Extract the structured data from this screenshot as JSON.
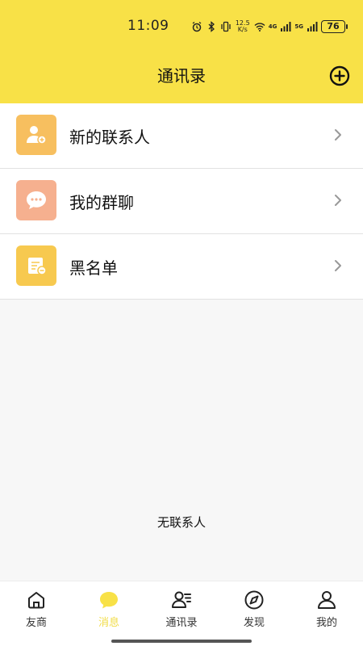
{
  "status_bar": {
    "time": "11:09",
    "net_speed_top": "12.5",
    "net_speed_bottom": "K/s",
    "signal1": "4G",
    "signal2": "5G",
    "battery": "76"
  },
  "header": {
    "title": "通讯录",
    "add_icon": "plus-circle-icon"
  },
  "list": {
    "items": [
      {
        "label": "新的联系人",
        "icon": "add-contact-icon",
        "color": "#f7bf5f"
      },
      {
        "label": "我的群聊",
        "icon": "chat-bubble-icon",
        "color": "#f6b08f"
      },
      {
        "label": "黑名单",
        "icon": "blacklist-icon",
        "color": "#f7c94f"
      }
    ]
  },
  "empty_state": {
    "text": "无联系人"
  },
  "bottom_nav": {
    "items": [
      {
        "label": "友商",
        "icon": "home-icon"
      },
      {
        "label": "消息",
        "icon": "message-icon",
        "active": true
      },
      {
        "label": "通讯录",
        "icon": "contacts-icon"
      },
      {
        "label": "发现",
        "icon": "compass-icon"
      },
      {
        "label": "我的",
        "icon": "person-icon"
      }
    ]
  },
  "colors": {
    "header_bg": "#f8e147",
    "active_tab": "#f1dc47"
  }
}
